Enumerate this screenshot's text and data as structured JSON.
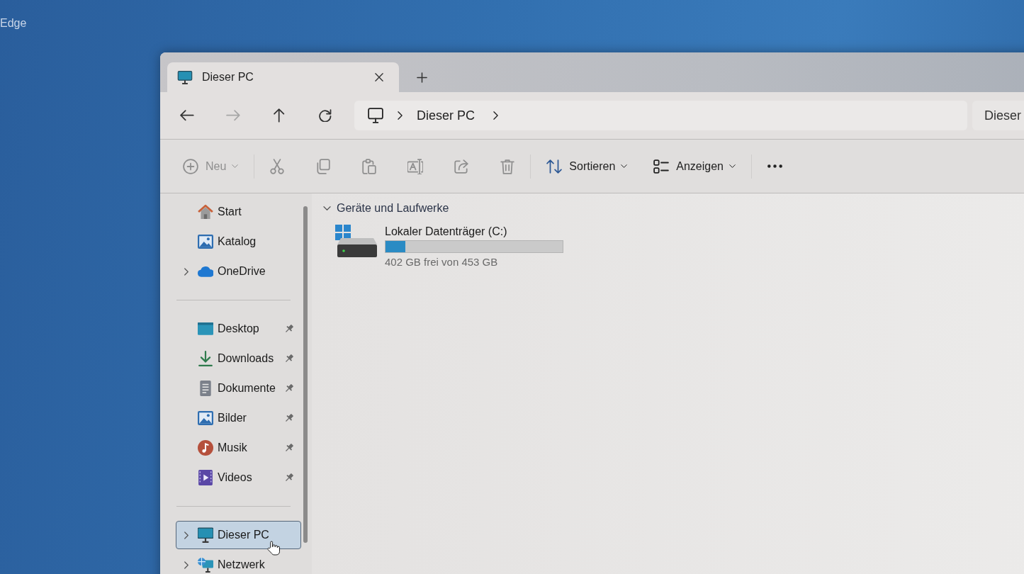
{
  "desktop": {
    "shortcut_label": "Edge"
  },
  "window": {
    "tabs": [
      {
        "title": "Dieser PC",
        "selected": true
      }
    ],
    "navigation": [
      {
        "kind": "back",
        "disabled": false
      },
      {
        "kind": "forward",
        "disabled": true
      },
      {
        "kind": "up",
        "disabled": false
      },
      {
        "kind": "refresh",
        "disabled": false
      }
    ],
    "address_bar": {
      "path": [
        "Dieser PC"
      ]
    },
    "search": {
      "placeholder": "Dieser"
    },
    "toolbar": [
      {
        "items": [
          {
            "kind": "new",
            "label": "Neu",
            "disabled": true
          }
        ]
      },
      {
        "items": [
          {
            "kind": "cut",
            "disabled": true
          },
          {
            "kind": "copy",
            "disabled": true
          },
          {
            "kind": "paste",
            "disabled": true
          },
          {
            "kind": "rename",
            "disabled": true
          },
          {
            "kind": "share",
            "disabled": true
          },
          {
            "kind": "delete",
            "disabled": true
          }
        ]
      },
      {
        "items": [
          {
            "kind": "sort",
            "label": "Sortieren",
            "disabled": false
          },
          {
            "kind": "view",
            "label": "Anzeigen",
            "disabled": false
          }
        ]
      },
      {
        "items": [
          {
            "kind": "more",
            "disabled": false
          }
        ]
      }
    ],
    "sidebar": {
      "groups": [
        {
          "items": [
            {
              "kind": "home",
              "label": "Start",
              "selected": false,
              "expandable": false,
              "pinned": false
            },
            {
              "kind": "gallery",
              "label": "Katalog",
              "selected": false,
              "expandable": false,
              "pinned": false
            },
            {
              "kind": "onedrive",
              "label": "OneDrive",
              "selected": false,
              "expandable": true,
              "pinned": false
            }
          ]
        },
        {
          "items": [
            {
              "kind": "desktop",
              "label": "Desktop",
              "selected": false,
              "expandable": false,
              "pinned": true
            },
            {
              "kind": "downloads",
              "label": "Downloads",
              "selected": false,
              "expandable": false,
              "pinned": true
            },
            {
              "kind": "documents",
              "label": "Dokumente",
              "selected": false,
              "expandable": false,
              "pinned": true
            },
            {
              "kind": "pictures",
              "label": "Bilder",
              "selected": false,
              "expandable": false,
              "pinned": true
            },
            {
              "kind": "music",
              "label": "Musik",
              "selected": false,
              "expandable": false,
              "pinned": true
            },
            {
              "kind": "videos",
              "label": "Videos",
              "selected": false,
              "expandable": false,
              "pinned": true
            }
          ]
        },
        {
          "items": [
            {
              "kind": "pc",
              "label": "Dieser PC",
              "selected": true,
              "expandable": true,
              "pinned": false
            },
            {
              "kind": "network",
              "label": "Netzwerk",
              "selected": false,
              "expandable": true,
              "pinned": false
            }
          ]
        }
      ]
    },
    "content": {
      "sections": [
        {
          "title": "Geräte und Laufwerke",
          "expanded": true,
          "drives": [
            {
              "name": "Lokaler Datenträger (C:)",
              "level": 0.11,
              "space": "402 GB frei von 453 GB"
            }
          ]
        }
      ]
    }
  }
}
